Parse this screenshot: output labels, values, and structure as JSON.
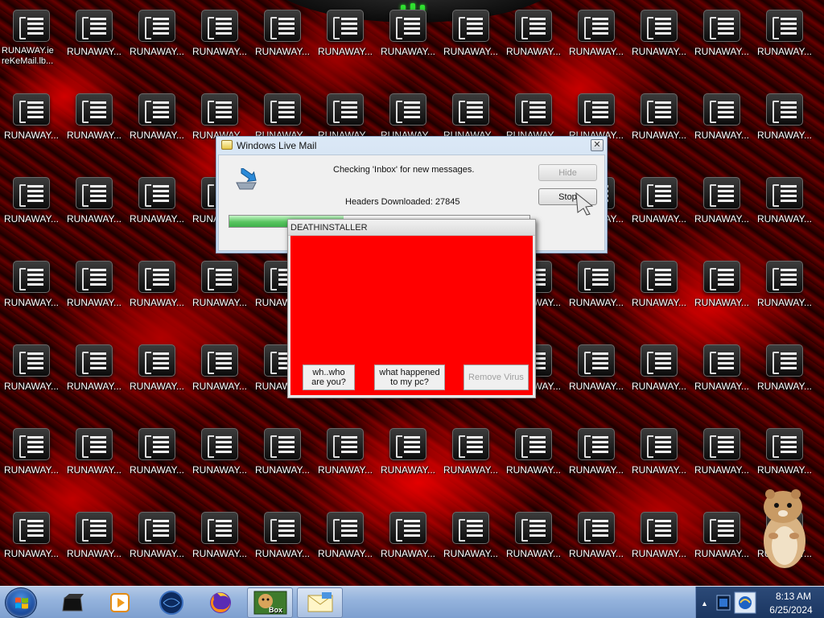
{
  "desktop": {
    "first_icon_label": "RUNAWAY.ie reKeMail.lb...",
    "icon_label": "RUNAWAY..."
  },
  "wlm": {
    "title": "Windows Live Mail",
    "close_glyph": "✕",
    "checking_text": "Checking 'Inbox' for new messages.",
    "headers_text": "Headers Downloaded: 27845",
    "progress_fraction": 0.38,
    "hide_label": "Hide",
    "stop_label": "Stop"
  },
  "deathinstaller": {
    "title": "DEATHINSTALLER",
    "background_color": "#ff0000",
    "who_label": "wh..who are you?",
    "what_label": "what happened to my pc?",
    "remove_label": "Remove Virus"
  },
  "taskbar": {
    "items": [
      "media-app-icon",
      "media-player-icon",
      "globe-browser-icon",
      "firefox-icon",
      "box-app-icon",
      "email-app-icon"
    ],
    "box_label": "Box",
    "time": "8:13 AM",
    "date": "6/25/2024",
    "arrow": "▲"
  }
}
